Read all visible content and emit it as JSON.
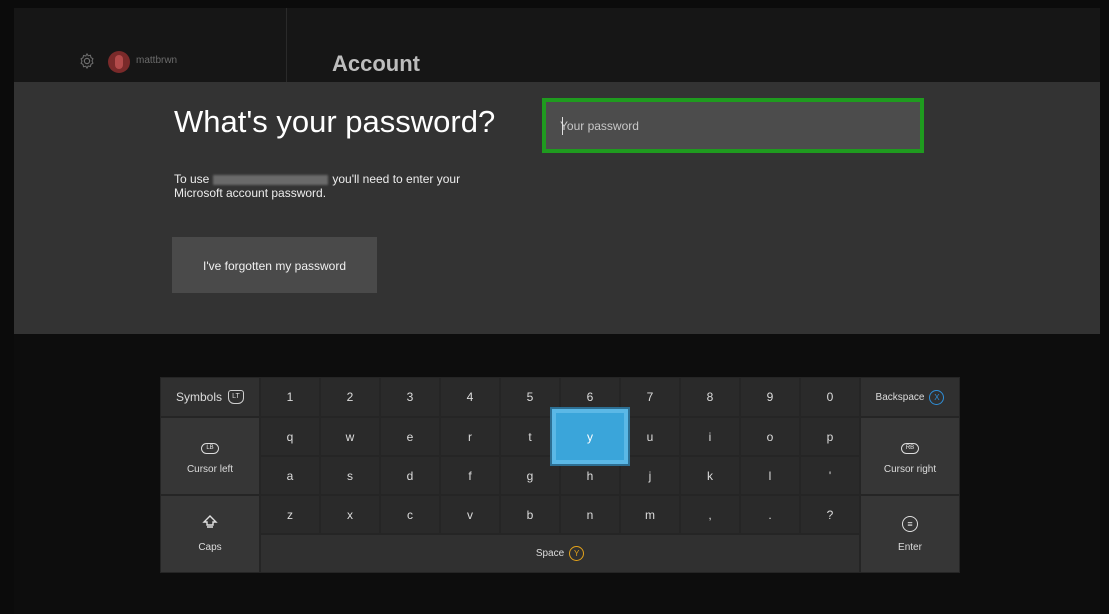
{
  "topbar": {
    "settings_icon": "gear-icon",
    "gamertag": "mattbrwn",
    "title": "Account"
  },
  "prompt": {
    "heading": "What's your password?",
    "desc_before": "To use",
    "desc_after": "you'll need to enter your",
    "desc_line2": "Microsoft account password.",
    "forgot_label": "I've forgotten my password"
  },
  "password": {
    "placeholder": "Your password",
    "value": ""
  },
  "keyboard": {
    "symbols_label": "Symbols",
    "symbols_badge": "LT",
    "backspace_label": "Backspace",
    "backspace_badge": "X",
    "cursor_left_label": "Cursor left",
    "cursor_left_badge": "LB",
    "cursor_right_label": "Cursor right",
    "cursor_right_badge": "RB",
    "caps_label": "Caps",
    "space_label": "Space",
    "space_badge": "Y",
    "enter_label": "Enter",
    "row_numbers": [
      "1",
      "2",
      "3",
      "4",
      "5",
      "6",
      "7",
      "8",
      "9",
      "0"
    ],
    "row_top": [
      "q",
      "w",
      "e",
      "r",
      "t",
      "y",
      "u",
      "i",
      "o",
      "p"
    ],
    "row_mid": [
      "a",
      "s",
      "d",
      "f",
      "g",
      "h",
      "j",
      "k",
      "l",
      "'"
    ],
    "row_bottom": [
      "z",
      "x",
      "c",
      "v",
      "b",
      "n",
      "m",
      ",",
      ".",
      "?"
    ],
    "selected_key": "y"
  },
  "colors": {
    "focus_green": "#1f9b1f",
    "selected_blue": "#3aa5da",
    "x_button": "#2f8fd8",
    "y_button": "#e3a21a"
  }
}
